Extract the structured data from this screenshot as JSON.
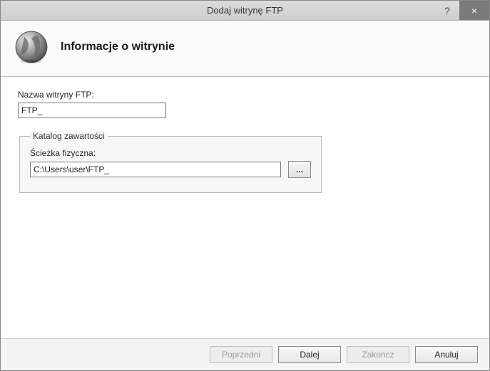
{
  "window": {
    "title": "Dodaj witrynę FTP",
    "help_label": "?",
    "close_label": "×"
  },
  "header": {
    "title": "Informacje o witrynie"
  },
  "form": {
    "site_name_label": "Nazwa witryny FTP:",
    "site_name_value": "FTP_",
    "fieldset_legend": "Katalog zawartości",
    "path_label": "Ścieżka fizyczna:",
    "path_value": "C:\\Users\\user\\FTP_",
    "browse_label": "..."
  },
  "buttons": {
    "previous": "Poprzedni",
    "next": "Dalej",
    "finish": "Zakończ",
    "cancel": "Anuluj"
  }
}
